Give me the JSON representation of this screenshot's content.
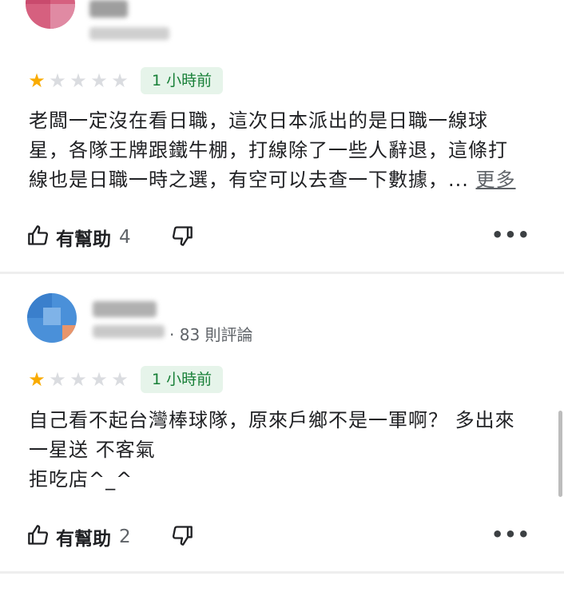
{
  "reviews": [
    {
      "rating": 1,
      "max_rating": 5,
      "time_ago": "1 小時前",
      "text": "老闆一定沒在看日職，這次日本派出的是日職一線球\n星，各隊王牌跟鐵牛棚，打線除了一些人辭退，這條打\n線也是日職一時之選，有空可以去查一下數據，... ",
      "more_label": "更多",
      "helpful_label": "有幫助",
      "helpful_count": "4",
      "icons": [
        "thumb-up-icon",
        "thumb-down-icon",
        "more-options-icon"
      ]
    },
    {
      "rating": 1,
      "max_rating": 5,
      "review_count": "· 83 則評論",
      "time_ago": "1 小時前",
      "text": "自己看不起台灣棒球隊，原來戶鄉不是一軍啊？ 多出來\n一星送 不客氣\n拒吃店^_^",
      "helpful_label": "有幫助",
      "helpful_count": "2",
      "icons": [
        "thumb-up-icon",
        "thumb-down-icon",
        "more-options-icon"
      ]
    }
  ],
  "colors": {
    "star_filled": "#f9ab00",
    "star_empty": "#dadce0",
    "badge_bg": "#e6f4ea",
    "badge_text": "#188038"
  }
}
